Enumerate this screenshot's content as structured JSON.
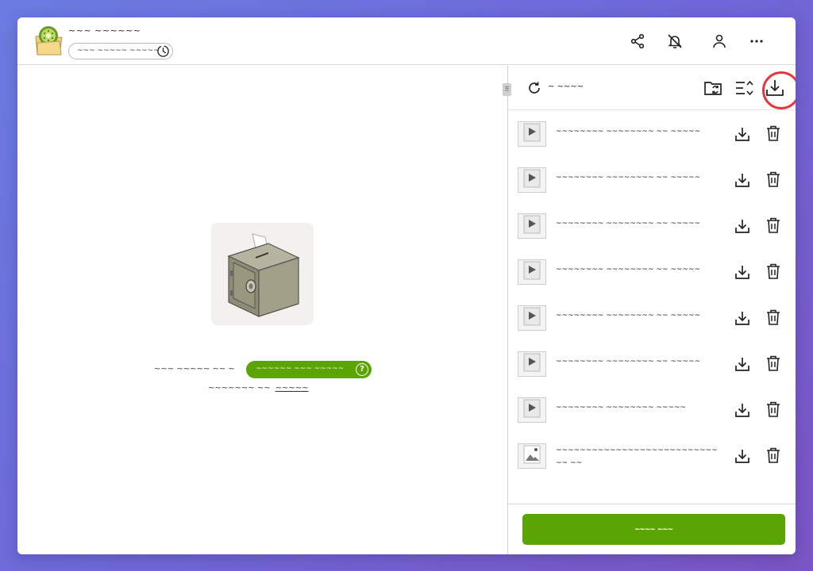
{
  "header": {
    "app_title": "~~~ ~~~~~~",
    "expiry_label": "~~~ ~~~~~ ~~~~~",
    "icons": [
      "share-icon",
      "bell-off-icon",
      "user-icon",
      "more-icon"
    ]
  },
  "main": {
    "empty_text": "~~~ ~~~~~ ~~ ~",
    "pill_label": "~~~~~~ ~~~ ~~~~~",
    "learn_text": "~~~~~~~ ~~",
    "learn_link": "~~~~~"
  },
  "sidebar": {
    "refresh_label": "~ ~~~~",
    "files": [
      {
        "name": "~~~~~~~~ ~~~~~~~~ ~~ ~~~~~",
        "type": "video"
      },
      {
        "name": "~~~~~~~~ ~~~~~~~~ ~~ ~~~~~",
        "type": "video"
      },
      {
        "name": "~~~~~~~~ ~~~~~~~~ ~~ ~~~~~",
        "type": "video"
      },
      {
        "name": "~~~~~~~~ ~~~~~~~~ ~~ ~~~~~",
        "type": "video"
      },
      {
        "name": "~~~~~~~~ ~~~~~~~~ ~~ ~~~~~",
        "type": "video"
      },
      {
        "name": "~~~~~~~~ ~~~~~~~~ ~~ ~~~~~",
        "type": "video"
      },
      {
        "name": "~~~~~~~~ ~~~~~~~~ ~~~~~",
        "type": "video"
      },
      {
        "name": "~~~~~~~~~~~~~~~~~~~~~~~~~~~ ~~ ~~",
        "type": "image"
      }
    ],
    "primary_button": "~~~~ ~~~"
  },
  "colors": {
    "accent_green": "#5aa404",
    "highlight_red": "#e8363b"
  }
}
